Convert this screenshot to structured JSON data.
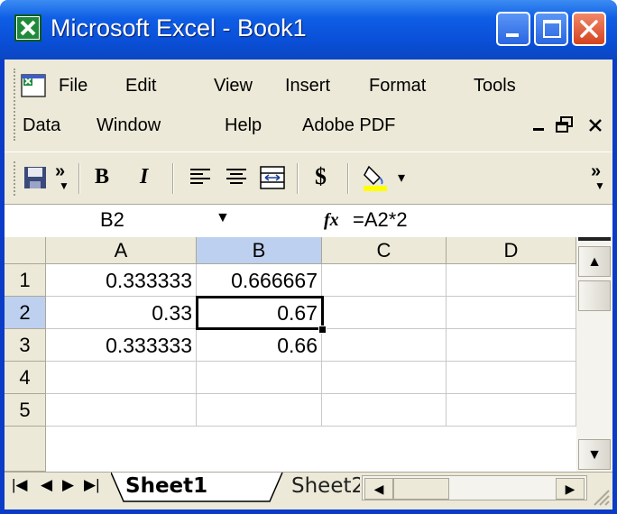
{
  "window": {
    "title": "Microsoft Excel - Book1"
  },
  "menu": {
    "row1": [
      "File",
      "Edit",
      "View",
      "Insert",
      "Format",
      "Tools"
    ],
    "row2": [
      "Data",
      "Window",
      "Help",
      "Adobe PDF"
    ]
  },
  "toolbar": {
    "more": "»",
    "bold": "B",
    "italic": "I",
    "currency": "$",
    "fill_dropdown": "▾",
    "end_more": "»"
  },
  "formula_bar": {
    "name_box": "B2",
    "fx": "fx",
    "formula": "=A2*2"
  },
  "grid": {
    "columns": [
      "A",
      "B",
      "C",
      "D"
    ],
    "rows": [
      "1",
      "2",
      "3",
      "4",
      "5"
    ],
    "cells": [
      [
        "0.333333",
        "0.666667",
        "",
        ""
      ],
      [
        "0.33",
        "0.67",
        "",
        ""
      ],
      [
        "0.333333",
        "0.66",
        "",
        ""
      ],
      [
        "",
        "",
        "",
        ""
      ],
      [
        "",
        "",
        "",
        ""
      ]
    ],
    "active_cell": "B2"
  },
  "sheets": {
    "tabs": [
      "Sheet1",
      "Sheet2"
    ],
    "active": "Sheet1"
  }
}
